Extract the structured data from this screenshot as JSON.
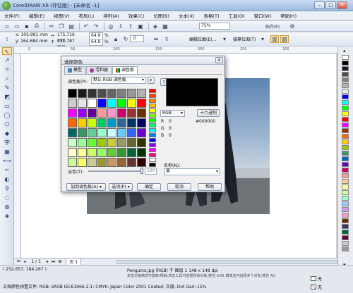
{
  "window": {
    "title": "CorelDRAW X6 (评估版) - [未命名 -1]",
    "min": "–",
    "max": "□",
    "close": "✕"
  },
  "menu": [
    "文件(F)",
    "编辑(E)",
    "视图(V)",
    "布局(L)",
    "排列(A)",
    "效果(C)",
    "位图(B)",
    "文本(X)",
    "表格(T)",
    "工具(O)",
    "窗口(W)",
    "帮助(H)"
  ],
  "toolbar1": {
    "zoom": "75%",
    "snap_label": "贴齐(P)"
  },
  "toolbar2": {
    "x": "x: 105.991 mm",
    "y": "y: 164.684 mm",
    "w": "175.716 mm",
    "h": "131.787 mm",
    "sx": "64.9",
    "sy": "64.9",
    "pct": "%",
    "angle": ".0",
    "edit_bitmap": "编辑位图(E)...",
    "trace_bitmap": "描摹位图(T)"
  },
  "ruler_marks": [
    "0",
    "50",
    "100",
    "150",
    "200",
    "250",
    "300"
  ],
  "dialog": {
    "title": "选择颜色",
    "tabs": [
      "模型",
      "混和器",
      "调色板"
    ],
    "palette_label": "调色板(P):",
    "palette_value": "默认 RGB 调色板",
    "model_value": "RGB",
    "hex_button": "十六进制",
    "channels": [
      {
        "name": "R",
        "value": "0"
      },
      {
        "name": "G",
        "value": "0"
      },
      {
        "name": "B",
        "value": "0"
      }
    ],
    "hex_value": "#000000",
    "tint_label": "淡色(T):",
    "tint_value": "100",
    "name_label": "名称(N):",
    "name_value": "黑",
    "buttons": {
      "add": "加到调色板(A)",
      "options": "选项(P)",
      "ok": "确定",
      "cancel": "取消",
      "help": "帮助"
    },
    "swatches": [
      "#000000",
      "#1a1a1a",
      "#333333",
      "#4d4d4d",
      "#666666",
      "#808080",
      "#999999",
      "#b3b3b3",
      "#cccccc",
      "#e6e6e6",
      "#ffffff",
      "#0000ff",
      "#00ffff",
      "#00ff00",
      "#ffff00",
      "#ff0000",
      "#ff00ff",
      "#9900ff",
      "#660099",
      "#ff9999",
      "#ff99cc",
      "#cc0066",
      "#993333",
      "#663300",
      "#ff6600",
      "#ffcc00",
      "#ccff00",
      "#00cc66",
      "#0099cc",
      "#336699",
      "#003366",
      "#000066",
      "#006666",
      "#339966",
      "#66cc99",
      "#99ffcc",
      "#ccffff",
      "#66ccff",
      "#3366ff",
      "#6600cc",
      "#ccffcc",
      "#99ff99",
      "#66ff33",
      "#99cc00",
      "#cccc33",
      "#999966",
      "#666633",
      "#333300",
      "#ffffcc",
      "#ffff99",
      "#ccff66",
      "#99ff66",
      "#66cc33",
      "#339933",
      "#006633",
      "#003300",
      "#ccff99",
      "#ffff66",
      "#cccc99",
      "#999933",
      "#cc9966",
      "#996633",
      "#663333",
      "#330000"
    ],
    "spectrum": [
      "#ff0000",
      "#ff4000",
      "#ff8000",
      "#ffbf00",
      "#ffff00",
      "#80ff00",
      "#00ff00",
      "#00ff80",
      "#00ffff",
      "#0080ff",
      "#0000ff",
      "#8000ff",
      "#ff00ff",
      "#ff0080",
      "#ffffff",
      "#000000"
    ]
  },
  "palette_colors": [
    "#ffffff",
    "#000000",
    "#1a1a1a",
    "#4d4d4d",
    "#808080",
    "#b3b3b3",
    "#e6e6e6",
    "#0000ff",
    "#00ffff",
    "#00ff00",
    "#ffff00",
    "#ff0000",
    "#ff00ff",
    "#993300",
    "#ff6600",
    "#ffcc00",
    "#99cc00",
    "#339966",
    "#0066cc",
    "#6600cc",
    "#cc0066",
    "#ff9999",
    "#ffcc99",
    "#ffff99",
    "#ccff99",
    "#99ffcc",
    "#99ccff",
    "#cc99ff",
    "#ff99cc",
    "#663300",
    "#333366",
    "#006633",
    "#660033",
    "#cccccc",
    "#999999"
  ],
  "pages": {
    "counter": "1 / 1",
    "tab": "页 1"
  },
  "status": {
    "coords": "( 252.657, 184.267 )",
    "image_info": "Penguins.jpg (RGB) 于 图层 1 148 x 148 dpi",
    "hint": "单击对象两次可旋转/倾斜;双击工具可选择所有对象;按住 Shift 键单击可选择多个对象;按住 Alt 键单击可进行挖掘;按住 Ctrl 并单击可在组中选择",
    "profile": "文档颜色预置文件: RGB: sRGB IEC61966-2.1; CMYK: Japan Color 2001 Coated; 灰度: Dot Gain 15%",
    "fill": "无",
    "outline": "无"
  }
}
